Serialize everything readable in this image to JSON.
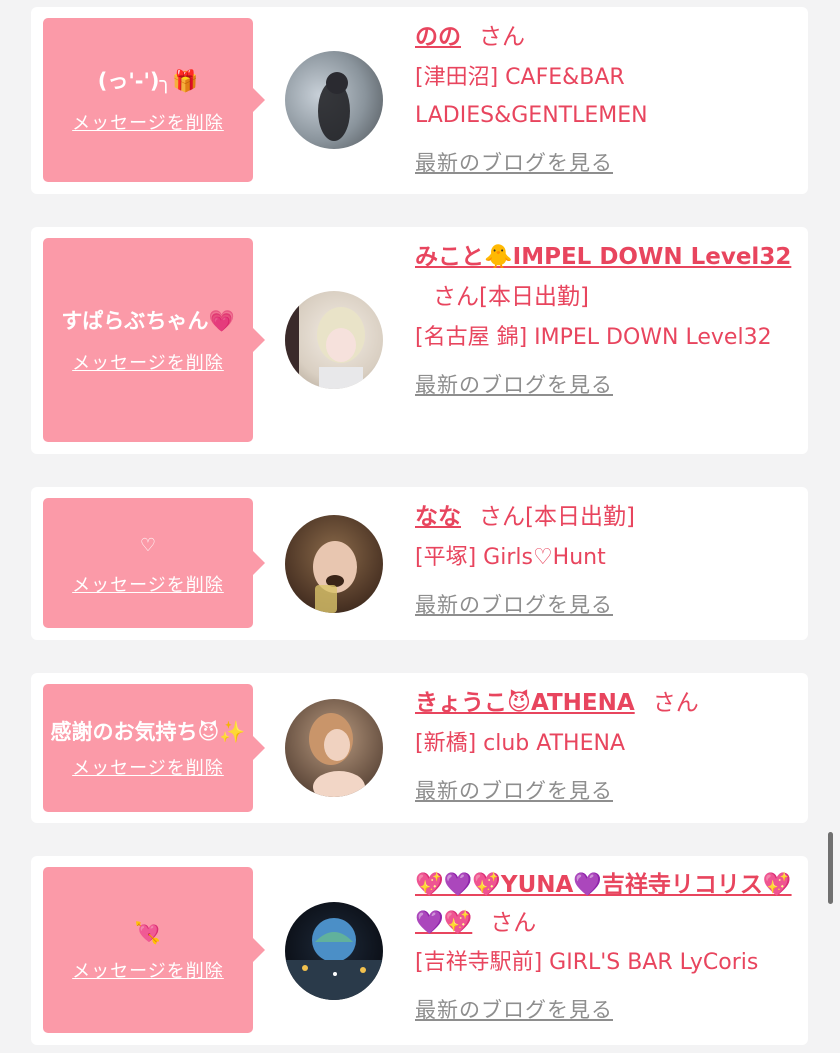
{
  "cards": [
    {
      "message": "(っ'-')╮🎁",
      "delete_label": "メッセージを削除",
      "name": "のの",
      "san": "さん",
      "status": "",
      "shop": "[津田沼] CAFE&BAR LADIES&GENTLEMEN",
      "blog_label": "最新のブログを見る",
      "avatar": "avatar-photo"
    },
    {
      "message": "すぱらぶちゃん💗",
      "delete_label": "メッセージを削除",
      "name": "みこと🐥IMPEL DOWN Level32",
      "san": "さん",
      "status": "[本日出勤]",
      "shop": "[名古屋 錦] IMPEL DOWN Level32",
      "blog_label": "最新のブログを見る",
      "avatar": "avatar-photo"
    },
    {
      "message": "♡",
      "delete_label": "メッセージを削除",
      "name": "なな",
      "san": "さん",
      "status": "[本日出勤]",
      "shop": "[平塚] Girls♡Hunt",
      "blog_label": "最新のブログを見る",
      "avatar": "avatar-photo"
    },
    {
      "message": "感謝のお気持ち😈✨",
      "delete_label": "メッセージを削除",
      "name": "きょうこ😈ATHENA",
      "san": "さん",
      "status": "",
      "shop": "[新橋] club ATHENA",
      "blog_label": "最新のブログを見る",
      "avatar": "avatar-photo"
    },
    {
      "message": "💘",
      "delete_label": "メッセージを削除",
      "name": "💖💜💖YUNA💜吉祥寺リコリス💖💜💖",
      "san": "さん",
      "status": "",
      "shop": "[吉祥寺駅前] GIRL'S BAR LyCoris",
      "blog_label": "最新のブログを見る",
      "avatar": "avatar-photo"
    }
  ]
}
